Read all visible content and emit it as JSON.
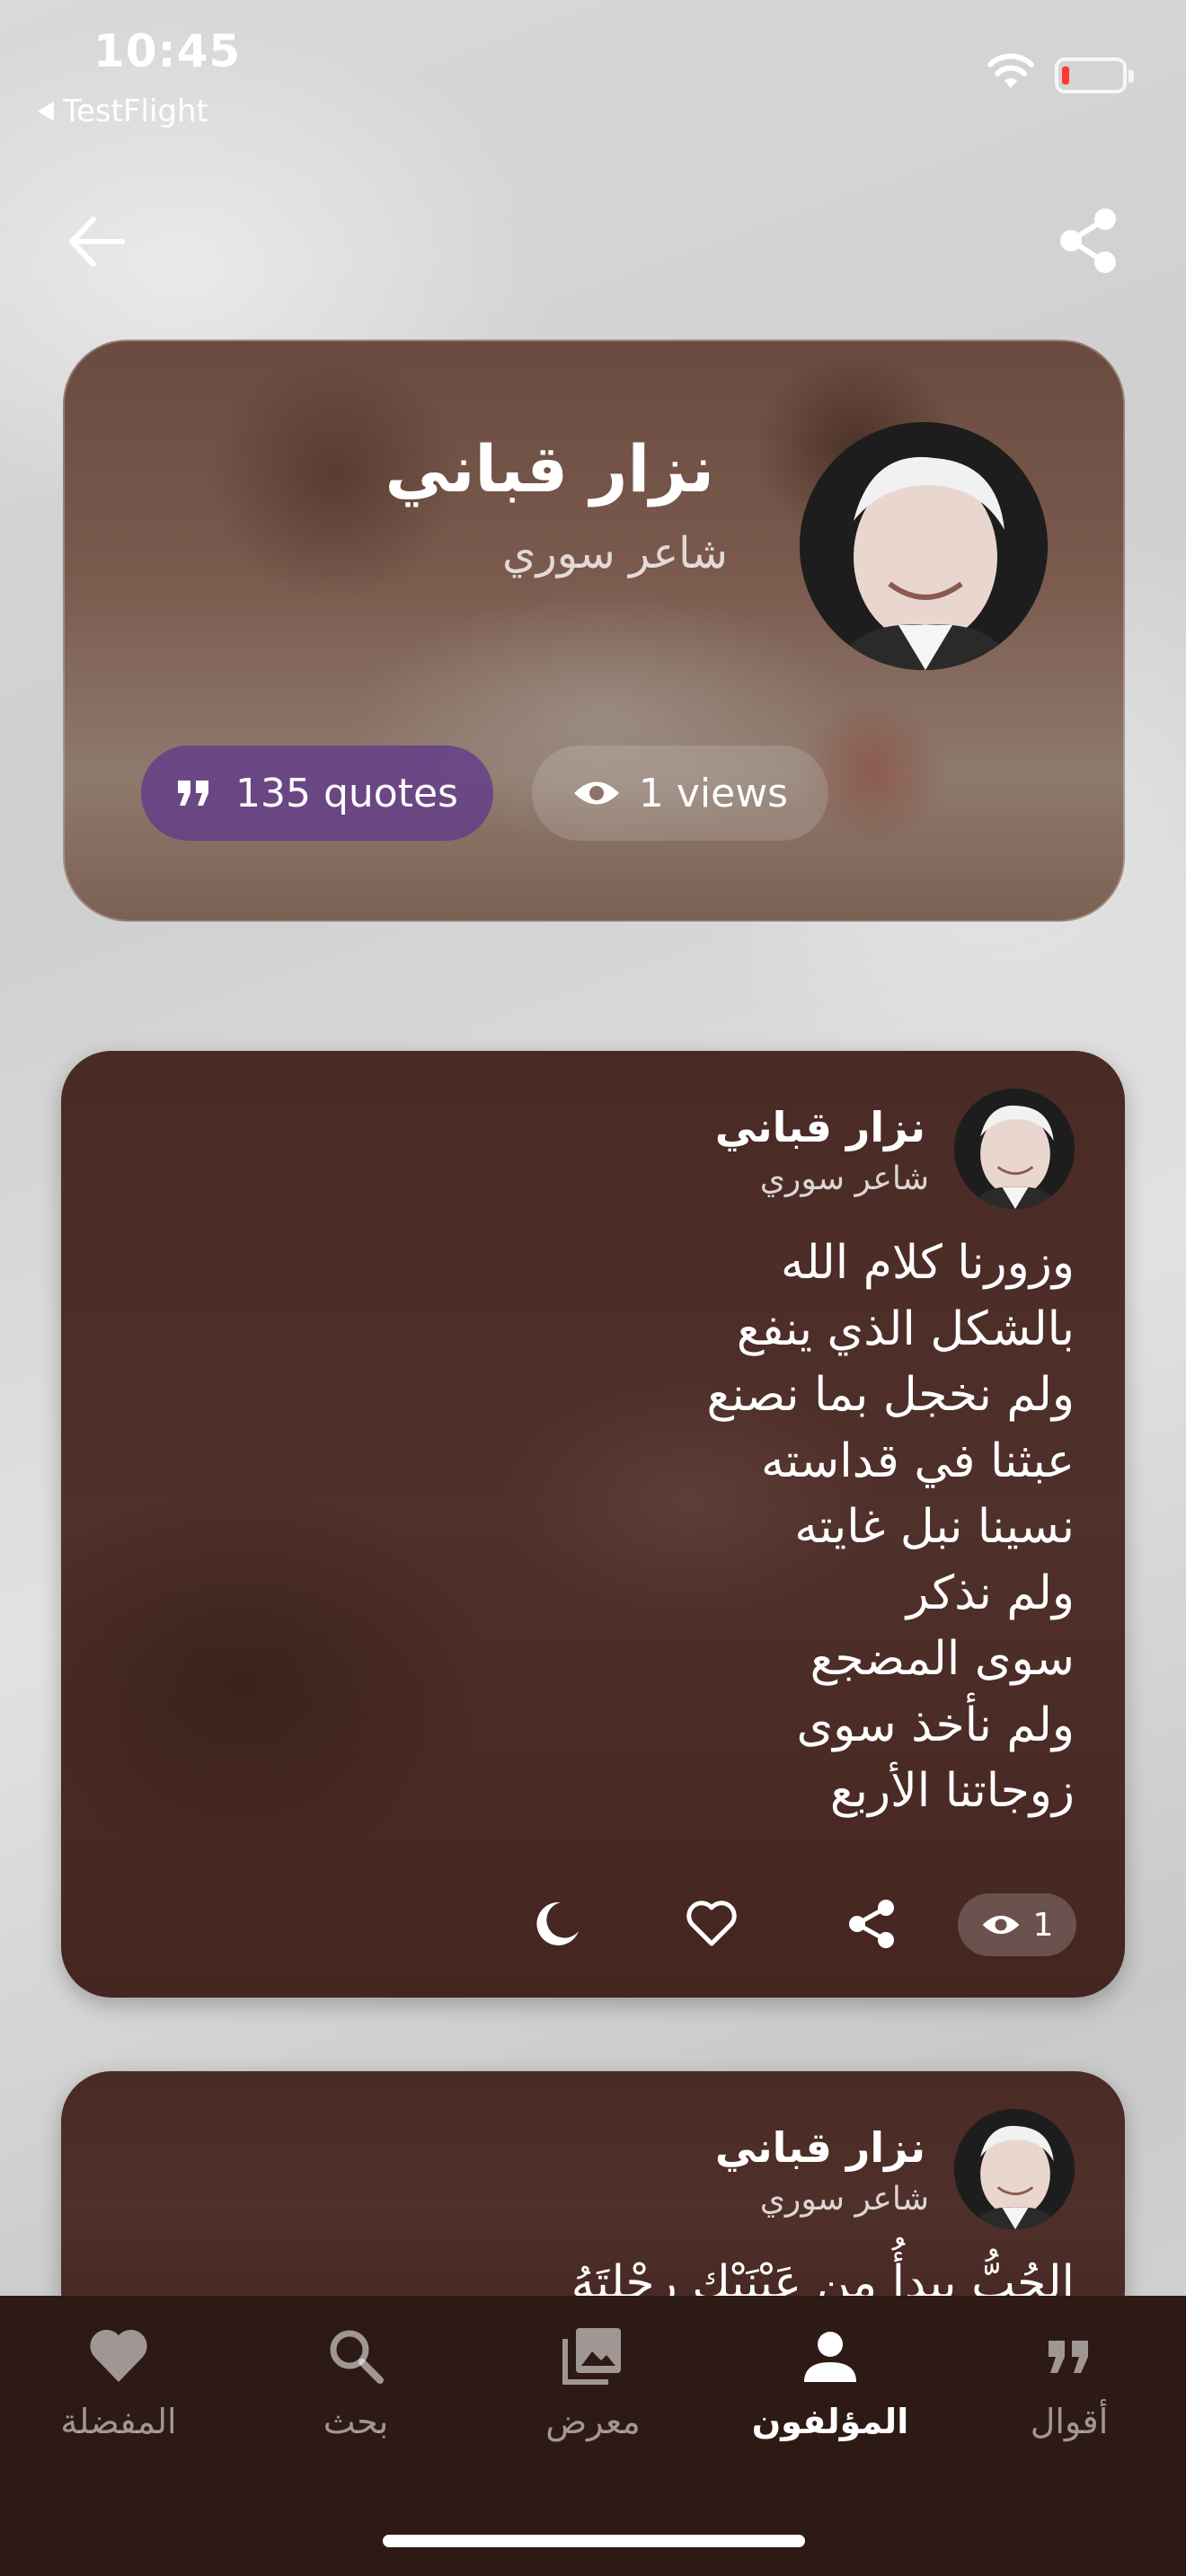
{
  "status_bar": {
    "time": "10:45",
    "back_app": "TestFlight"
  },
  "author": {
    "name": "نزار قباني",
    "subtitle": "شاعر سوري",
    "quotes_count": "135 quotes",
    "views_count": "1 views"
  },
  "quotes": [
    {
      "author_name": "نزار قباني",
      "author_subtitle": "شاعر سوري",
      "lines": [
        "وزورنا كلام الله",
        "بالشكل الذي ينفع",
        "ولم نخجل بما نصنع",
        "عبثنا في قداسته",
        "نسينا نبل غايته",
        "ولم نذكر",
        "سوى المضجع",
        "ولم نأخذ سوى",
        "زوجاتنا الأربع"
      ],
      "views": "1"
    },
    {
      "author_name": "نزار قباني",
      "author_subtitle": "شاعر سوري",
      "lines": [
        "الحُبُّ يبدأُ من عَيْنَيْكِ رحْلتَهُ"
      ]
    }
  ],
  "nav": {
    "items": [
      {
        "label": "أقوال",
        "icon": "quote-icon"
      },
      {
        "label": "المؤلفون",
        "icon": "person-icon",
        "active": true
      },
      {
        "label": "معرض",
        "icon": "gallery-icon"
      },
      {
        "label": "بحث",
        "icon": "search-icon"
      },
      {
        "label": "المفضلة",
        "icon": "heart-icon"
      }
    ]
  },
  "colors": {
    "nav_bg": "#2e1a14",
    "quote_pill": "#5f378c",
    "card_bg": "#4a2a25"
  }
}
